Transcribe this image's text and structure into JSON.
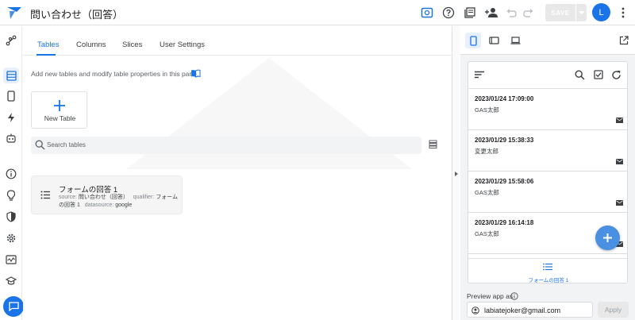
{
  "app": {
    "title": "問い合わせ（回答）"
  },
  "toolbar": {
    "save_label": "SAVE",
    "avatar_initial": "L"
  },
  "rail": {
    "items": [
      "connections-icon",
      "data-icon",
      "app-icon",
      "automation-icon",
      "bot-icon",
      "info-icon",
      "intelligence-icon",
      "security-icon",
      "settings-icon",
      "monitor-icon",
      "learn-icon",
      "chat-icon"
    ]
  },
  "tabs": [
    {
      "label": "Tables",
      "active": true
    },
    {
      "label": "Columns",
      "active": false
    },
    {
      "label": "Slices",
      "active": false
    },
    {
      "label": "User Settings",
      "active": false
    }
  ],
  "main": {
    "description": "Add new tables and modify table properties in this pane.",
    "new_table_label": "New Table",
    "search_placeholder": "Search tables"
  },
  "table_card": {
    "name": "フォームの回答 1",
    "source_label": "source:",
    "source_value": "問い合わせ（回答）",
    "qualifier_label": "qualifier:",
    "qualifier_value": "フォームの回答 1",
    "datasource_label": "datasource:",
    "datasource_value": "google"
  },
  "preview": {
    "records": [
      {
        "datetime": "2023/01/24 17:09:00",
        "name": "GAS太郎"
      },
      {
        "datetime": "2023/01/29 15:38:33",
        "name": "変更太郎"
      },
      {
        "datetime": "2023/01/29 15:58:06",
        "name": "GAS太郎"
      },
      {
        "datetime": "2023/01/29 16:14:18",
        "name": "GAS太郎"
      }
    ],
    "nav_label": "フォームの回答 1",
    "preview_as_label": "Preview app as",
    "email": "labiatejoker@gmail.com",
    "apply_label": "Apply"
  },
  "colors": {
    "accent": "#1a73e8",
    "fab": "#4a90e2"
  }
}
